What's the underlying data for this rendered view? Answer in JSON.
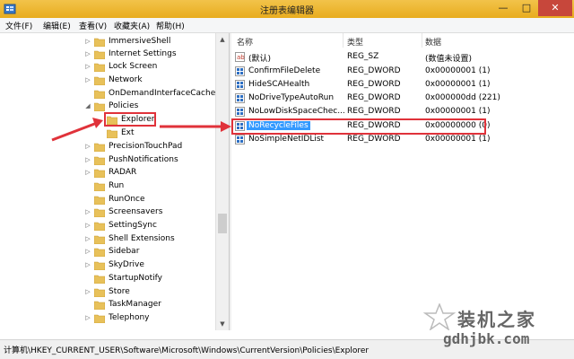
{
  "window": {
    "title": "注册表编辑器",
    "minimize": "—",
    "maximize": "□",
    "close": "✕"
  },
  "menu": [
    "文件(F)",
    "编辑(E)",
    "查看(V)",
    "收藏夹(A)",
    "帮助(H)"
  ],
  "tree": {
    "items": [
      {
        "label": "ImmersiveShell",
        "expander": "▷"
      },
      {
        "label": "Internet Settings",
        "expander": "▷"
      },
      {
        "label": "Lock Screen",
        "expander": "▷"
      },
      {
        "label": "Network",
        "expander": "▷"
      },
      {
        "label": "OnDemandInterfaceCache",
        "expander": ""
      },
      {
        "label": "Policies",
        "expander": "◢"
      },
      {
        "label": "Explorer",
        "expander": ""
      },
      {
        "label": "Ext",
        "expander": ""
      },
      {
        "label": "PrecisionTouchPad",
        "expander": "▷"
      },
      {
        "label": "PushNotifications",
        "expander": "▷"
      },
      {
        "label": "RADAR",
        "expander": "▷"
      },
      {
        "label": "Run",
        "expander": ""
      },
      {
        "label": "RunOnce",
        "expander": ""
      },
      {
        "label": "Screensavers",
        "expander": "▷"
      },
      {
        "label": "SettingSync",
        "expander": "▷"
      },
      {
        "label": "Shell Extensions",
        "expander": "▷"
      },
      {
        "label": "Sidebar",
        "expander": "▷"
      },
      {
        "label": "SkyDrive",
        "expander": "▷"
      },
      {
        "label": "StartupNotify",
        "expander": ""
      },
      {
        "label": "Store",
        "expander": "▷"
      },
      {
        "label": "TaskManager",
        "expander": ""
      },
      {
        "label": "Telephony",
        "expander": "▷"
      }
    ]
  },
  "list": {
    "headers": {
      "name": "名称",
      "type": "类型",
      "data": "数据"
    },
    "rows": [
      {
        "name": "(默认)",
        "type": "REG_SZ",
        "data": "(数值未设置)",
        "icon": "string-value-icon"
      },
      {
        "name": "ConfirmFileDelete",
        "type": "REG_DWORD",
        "data": "0x00000001 (1)",
        "icon": "dword-value-icon"
      },
      {
        "name": "HideSCAHealth",
        "type": "REG_DWORD",
        "data": "0x00000001 (1)",
        "icon": "dword-value-icon"
      },
      {
        "name": "NoDriveTypeAutoRun",
        "type": "REG_DWORD",
        "data": "0x000000dd (221)",
        "icon": "dword-value-icon"
      },
      {
        "name": "NoLowDiskSpaceChec...",
        "type": "REG_DWORD",
        "data": "0x00000001 (1)",
        "icon": "dword-value-icon"
      },
      {
        "name": "NoRecycleFiles",
        "type": "REG_DWORD",
        "data": "0x00000000 (0)",
        "icon": "dword-value-icon"
      },
      {
        "name": "NoSimpleNetIDList",
        "type": "REG_DWORD",
        "data": "0x00000001 (1)",
        "icon": "dword-value-icon"
      }
    ]
  },
  "status": {
    "path": "计算机\\HKEY_CURRENT_USER\\Software\\Microsoft\\Windows\\CurrentVersion\\Policies\\Explorer"
  },
  "watermark": {
    "title": "装机之家",
    "url": "gdhjbk.com"
  },
  "colors": {
    "highlight": "#3399ff",
    "annotation": "#e0323a",
    "titlebar": "#ecb22e"
  }
}
